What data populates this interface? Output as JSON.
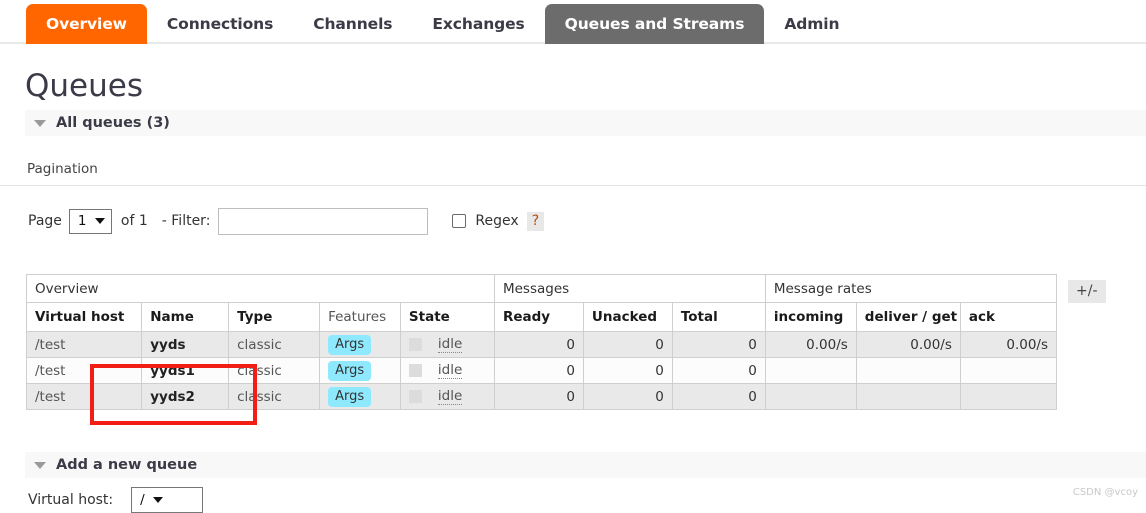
{
  "nav": {
    "tabs": [
      {
        "label": "Overview",
        "style": "orange"
      },
      {
        "label": "Connections",
        "style": "normal"
      },
      {
        "label": "Channels",
        "style": "normal"
      },
      {
        "label": "Exchanges",
        "style": "normal"
      },
      {
        "label": "Queues and Streams",
        "style": "active"
      },
      {
        "label": "Admin",
        "style": "normal"
      }
    ]
  },
  "page": {
    "title": "Queues"
  },
  "sections": {
    "all_queues": "All queues (3)",
    "add_queue": "Add a new queue"
  },
  "pagination": {
    "heading": "Pagination",
    "page_label": "Page",
    "page_value": "1",
    "of_total": "of 1",
    "filter_label": "- Filter:",
    "filter_value": "",
    "filter_placeholder": "",
    "regex_label": "Regex",
    "regex_help": "?",
    "regex_checked": false
  },
  "table": {
    "group_headers": [
      {
        "label": "Overview",
        "span": 5
      },
      {
        "label": "Messages",
        "span": 3
      },
      {
        "label": "Message rates",
        "span": 3
      }
    ],
    "columns": [
      {
        "label": "Virtual host",
        "sortable": true,
        "align": "left"
      },
      {
        "label": "Name",
        "sortable": true,
        "align": "left"
      },
      {
        "label": "Type",
        "sortable": true,
        "align": "left"
      },
      {
        "label": "Features",
        "sortable": false,
        "align": "left"
      },
      {
        "label": "State",
        "sortable": true,
        "align": "left"
      },
      {
        "label": "Ready",
        "sortable": true,
        "align": "left"
      },
      {
        "label": "Unacked",
        "sortable": true,
        "align": "left"
      },
      {
        "label": "Total",
        "sortable": true,
        "align": "left"
      },
      {
        "label": "incoming",
        "sortable": true,
        "align": "left"
      },
      {
        "label": "deliver / get",
        "sortable": true,
        "align": "left"
      },
      {
        "label": "ack",
        "sortable": true,
        "align": "left"
      }
    ],
    "toggle_columns_button": "+/-",
    "rows": [
      {
        "vhost": "/test",
        "name": "yyds",
        "type": "classic",
        "features": "Args",
        "state": "idle",
        "ready": "0",
        "unacked": "0",
        "total": "0",
        "incoming": "0.00/s",
        "deliver_get": "0.00/s",
        "ack": "0.00/s",
        "shaded": true
      },
      {
        "vhost": "/test",
        "name": "yyds1",
        "type": "classic",
        "features": "Args",
        "state": "idle",
        "ready": "0",
        "unacked": "0",
        "total": "0",
        "incoming": "",
        "deliver_get": "",
        "ack": "",
        "shaded": false
      },
      {
        "vhost": "/test",
        "name": "yyds2",
        "type": "classic",
        "features": "Args",
        "state": "idle",
        "ready": "0",
        "unacked": "0",
        "total": "0",
        "incoming": "",
        "deliver_get": "",
        "ack": "",
        "shaded": true
      }
    ]
  },
  "add_queue_form": {
    "vhost_label": "Virtual host:",
    "vhost_value": "/"
  },
  "annotation": {
    "color": "#f21e15"
  },
  "watermark": {
    "text": "CSDN @vcoy"
  }
}
